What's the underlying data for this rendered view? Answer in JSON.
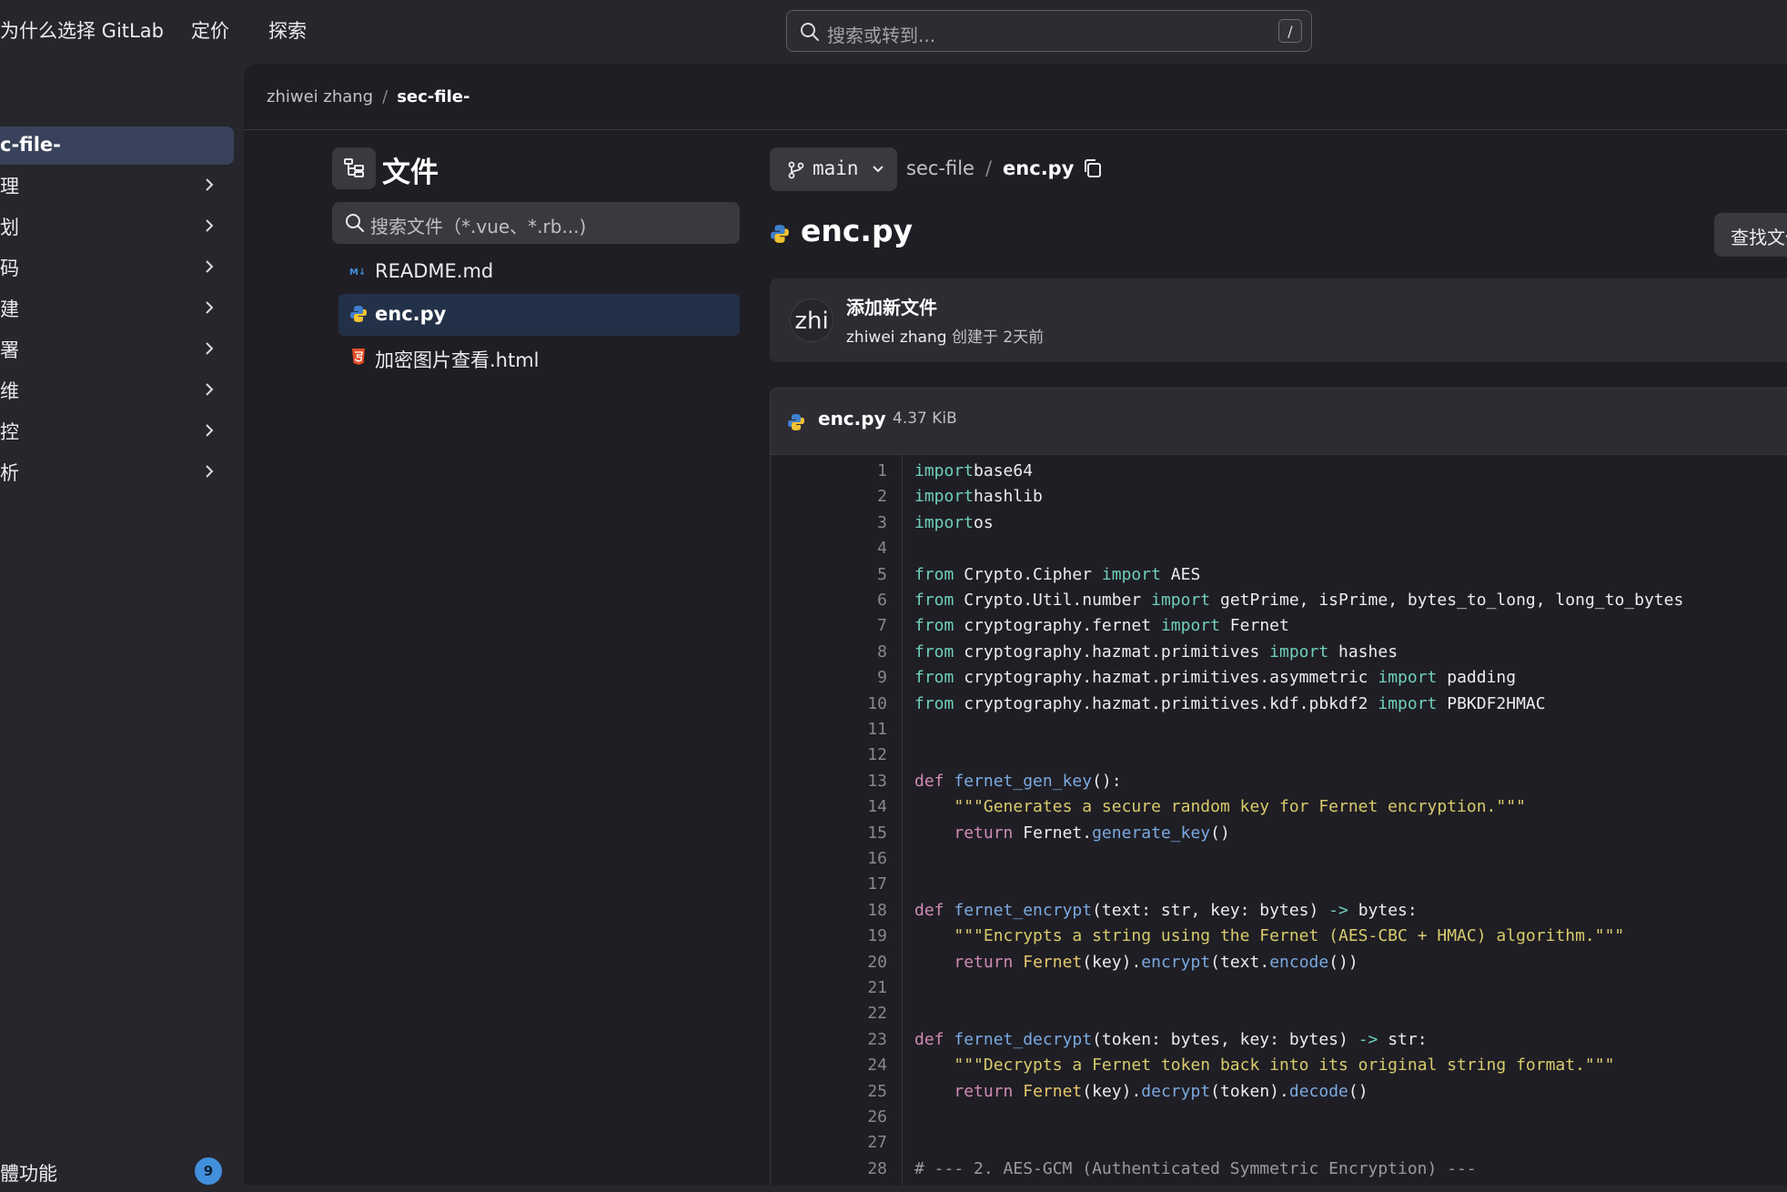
{
  "topbar": {
    "nav": [
      "为什么选择 GitLab",
      "定价",
      "探索"
    ],
    "search_placeholder": "搜索或转到...",
    "search_shortcut": "/"
  },
  "sidebar": {
    "active_project": "c-file-",
    "items": [
      "理",
      "划",
      "码",
      "建",
      "署",
      "维",
      "控",
      "析"
    ],
    "bottom_label": "體功能",
    "bottom_badge": "9"
  },
  "breadcrumb": {
    "owner": "zhiwei zhang",
    "separator": "/",
    "project": "sec-file-"
  },
  "file_tree": {
    "title": "文件",
    "search_placeholder": "搜索文件（*.vue、*.rb...)",
    "files": [
      {
        "name": "README.md",
        "icon": "markdown-icon"
      },
      {
        "name": "enc.py",
        "icon": "python-icon"
      },
      {
        "name": "加密图片查看.html",
        "icon": "html-icon"
      }
    ]
  },
  "file_view": {
    "branch": "main",
    "path_root": "sec-file",
    "path_sep": "/",
    "path_file": "enc.py",
    "heading": "enc.py",
    "find_button": "查找文件",
    "commit": {
      "avatar": "zhi",
      "title": "添加新文件",
      "author": "zhiwei zhang",
      "meta": "创建于 2天前"
    },
    "blob": {
      "name": "enc.py",
      "size": "4.37 KiB"
    }
  },
  "code_lines": [
    [
      [
        "kw",
        "import"
      ],
      [
        "",
        "base64"
      ]
    ],
    [
      [
        "kw",
        "import"
      ],
      [
        "",
        "hashlib"
      ]
    ],
    [
      [
        "kw",
        "import"
      ],
      [
        "",
        "os"
      ]
    ],
    [],
    [
      [
        "kw",
        "from"
      ],
      [
        "",
        " Crypto.Cipher "
      ],
      [
        "kw",
        "import"
      ],
      [
        "",
        " AES"
      ]
    ],
    [
      [
        "kw",
        "from"
      ],
      [
        "",
        " Crypto.Util.number "
      ],
      [
        "kw",
        "import"
      ],
      [
        "",
        " getPrime, isPrime, bytes_to_long, long_to_bytes"
      ]
    ],
    [
      [
        "kw",
        "from"
      ],
      [
        "",
        " cryptography.fernet "
      ],
      [
        "kw",
        "import"
      ],
      [
        "",
        " Fernet"
      ]
    ],
    [
      [
        "kw",
        "from"
      ],
      [
        "",
        " cryptography.hazmat.primitives "
      ],
      [
        "kw",
        "import"
      ],
      [
        "",
        " hashes"
      ]
    ],
    [
      [
        "kw",
        "from"
      ],
      [
        "",
        " cryptography.hazmat.primitives.asymmetric "
      ],
      [
        "kw",
        "import"
      ],
      [
        "",
        " padding"
      ]
    ],
    [
      [
        "kw",
        "from"
      ],
      [
        "",
        " cryptography.hazmat.primitives.kdf.pbkdf2 "
      ],
      [
        "kw",
        "import"
      ],
      [
        "",
        " PBKDF2HMAC"
      ]
    ],
    [],
    [],
    [
      [
        "def",
        "def"
      ],
      [
        "",
        " "
      ],
      [
        "fn",
        "fernet_gen_key"
      ],
      [
        "",
        "():"
      ]
    ],
    [
      [
        "",
        "    "
      ],
      [
        "str",
        "\"\"\"Generates a secure random key for Fernet encryption.\"\"\""
      ]
    ],
    [
      [
        "",
        "    "
      ],
      [
        "def",
        "return"
      ],
      [
        "",
        " Fernet."
      ],
      [
        "fn",
        "generate_key"
      ],
      [
        "",
        "()"
      ]
    ],
    [],
    [],
    [
      [
        "def",
        "def"
      ],
      [
        "",
        " "
      ],
      [
        "fn",
        "fernet_encrypt"
      ],
      [
        "",
        "(text: str, key: bytes) "
      ],
      [
        "op",
        "->"
      ],
      [
        "",
        " bytes:"
      ]
    ],
    [
      [
        "",
        "    "
      ],
      [
        "str",
        "\"\"\"Encrypts a string using the Fernet (AES-CBC + HMAC) algorithm.\"\"\""
      ]
    ],
    [
      [
        "",
        "    "
      ],
      [
        "def",
        "return"
      ],
      [
        "",
        " "
      ],
      [
        "cls",
        "Fernet"
      ],
      [
        "",
        "(key)."
      ],
      [
        "fn",
        "encrypt"
      ],
      [
        "",
        "(text."
      ],
      [
        "fn",
        "encode"
      ],
      [
        "",
        "())"
      ]
    ],
    [],
    [],
    [
      [
        "def",
        "def"
      ],
      [
        "",
        " "
      ],
      [
        "fn",
        "fernet_decrypt"
      ],
      [
        "",
        "(token: bytes, key: bytes) "
      ],
      [
        "op",
        "->"
      ],
      [
        "",
        " str:"
      ]
    ],
    [
      [
        "",
        "    "
      ],
      [
        "str",
        "\"\"\"Decrypts a Fernet token back into its original string format.\"\"\""
      ]
    ],
    [
      [
        "",
        "    "
      ],
      [
        "def",
        "return"
      ],
      [
        "",
        " "
      ],
      [
        "cls",
        "Fernet"
      ],
      [
        "",
        "(key)."
      ],
      [
        "fn",
        "decrypt"
      ],
      [
        "",
        "(token)."
      ],
      [
        "fn",
        "decode"
      ],
      [
        "",
        "()"
      ]
    ],
    [],
    [],
    [
      [
        "cm",
        "# --- 2. AES-GCM (Authenticated Symmetric Encryption) ---"
      ]
    ]
  ],
  "colors": {
    "keyword": "#6fcfba",
    "def": "#cf8ab6",
    "function": "#7ba9e0",
    "class": "#e7c86e",
    "string": "#d8cb6c",
    "comment": "#9b9aa0"
  }
}
